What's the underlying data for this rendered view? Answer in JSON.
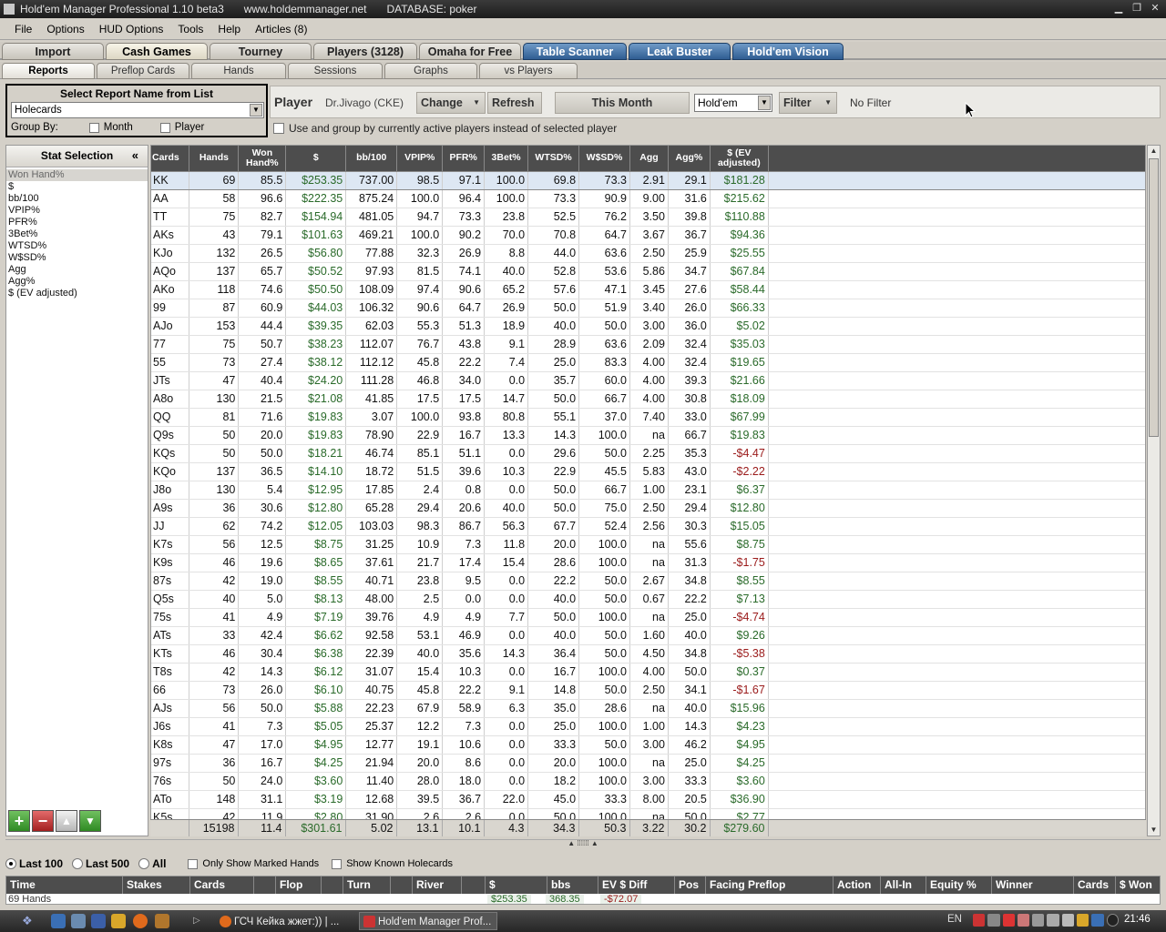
{
  "titlebar": {
    "app": "Hold'em Manager Professional 1.10 beta3",
    "site": "www.holdemmanager.net",
    "database": "DATABASE: poker"
  },
  "menu": [
    "File",
    "Options",
    "HUD Options",
    "Tools",
    "Help",
    "Articles (8)"
  ],
  "main_tabs": [
    "Import",
    "Cash Games",
    "Tourney",
    "Players (3128)",
    "Omaha for Free",
    "Table Scanner",
    "Leak Buster",
    "Hold'em Vision"
  ],
  "sub_tabs": [
    "Reports",
    "Preflop Cards",
    "Hands",
    "Sessions",
    "Graphs",
    "vs Players"
  ],
  "report_select": {
    "title": "Select Report Name from List",
    "value": "Holecards",
    "group_by": "Group By:",
    "month": "Month",
    "player": "Player"
  },
  "player_bar": {
    "label": "Player",
    "name": "Dr.Jivago (CKE)",
    "change": "Change",
    "refresh": "Refresh",
    "period": "This Month",
    "game": "Hold'em",
    "filter": "Filter",
    "filter_value": "No Filter"
  },
  "active_players_label": "Use and group by currently active players instead of selected player",
  "stat_selection": {
    "title": "Stat Selection",
    "collapse": "«",
    "items": [
      "Won Hand%",
      "$",
      "bb/100",
      "VPIP%",
      "PFR%",
      "3Bet%",
      "WTSD%",
      "W$SD%",
      "Agg",
      "Agg%",
      "$ (EV adjusted)"
    ],
    "buttons": [
      "+",
      "−",
      "▲",
      "▼"
    ]
  },
  "grid": {
    "columns": [
      "Cards",
      "Hands",
      "Won Hand%",
      "$",
      "bb/100",
      "VPIP%",
      "PFR%",
      "3Bet%",
      "WTSD%",
      "W$SD%",
      "Agg",
      "Agg%",
      "$ (EV adjusted)"
    ],
    "rows": [
      [
        "KK",
        "69",
        "85.5",
        "$253.35",
        "737.00",
        "98.5",
        "97.1",
        "100.0",
        "69.8",
        "73.3",
        "2.91",
        "29.1",
        "$181.28"
      ],
      [
        "AA",
        "58",
        "96.6",
        "$222.35",
        "875.24",
        "100.0",
        "96.4",
        "100.0",
        "73.3",
        "90.9",
        "9.00",
        "31.6",
        "$215.62"
      ],
      [
        "TT",
        "75",
        "82.7",
        "$154.94",
        "481.05",
        "94.7",
        "73.3",
        "23.8",
        "52.5",
        "76.2",
        "3.50",
        "39.8",
        "$110.88"
      ],
      [
        "AKs",
        "43",
        "79.1",
        "$101.63",
        "469.21",
        "100.0",
        "90.2",
        "70.0",
        "70.8",
        "64.7",
        "3.67",
        "36.7",
        "$94.36"
      ],
      [
        "KJo",
        "132",
        "26.5",
        "$56.80",
        "77.88",
        "32.3",
        "26.9",
        "8.8",
        "44.0",
        "63.6",
        "2.50",
        "25.9",
        "$25.55"
      ],
      [
        "AQo",
        "137",
        "65.7",
        "$50.52",
        "97.93",
        "81.5",
        "74.1",
        "40.0",
        "52.8",
        "53.6",
        "5.86",
        "34.7",
        "$67.84"
      ],
      [
        "AKo",
        "118",
        "74.6",
        "$50.50",
        "108.09",
        "97.4",
        "90.6",
        "65.2",
        "57.6",
        "47.1",
        "3.45",
        "27.6",
        "$58.44"
      ],
      [
        "99",
        "87",
        "60.9",
        "$44.03",
        "106.32",
        "90.6",
        "64.7",
        "26.9",
        "50.0",
        "51.9",
        "3.40",
        "26.0",
        "$66.33"
      ],
      [
        "AJo",
        "153",
        "44.4",
        "$39.35",
        "62.03",
        "55.3",
        "51.3",
        "18.9",
        "40.0",
        "50.0",
        "3.00",
        "36.0",
        "$5.02"
      ],
      [
        "77",
        "75",
        "50.7",
        "$38.23",
        "112.07",
        "76.7",
        "43.8",
        "9.1",
        "28.9",
        "63.6",
        "2.09",
        "32.4",
        "$35.03"
      ],
      [
        "55",
        "73",
        "27.4",
        "$38.12",
        "112.12",
        "45.8",
        "22.2",
        "7.4",
        "25.0",
        "83.3",
        "4.00",
        "32.4",
        "$19.65"
      ],
      [
        "JTs",
        "47",
        "40.4",
        "$24.20",
        "111.28",
        "46.8",
        "34.0",
        "0.0",
        "35.7",
        "60.0",
        "4.00",
        "39.3",
        "$21.66"
      ],
      [
        "A8o",
        "130",
        "21.5",
        "$21.08",
        "41.85",
        "17.5",
        "17.5",
        "14.7",
        "50.0",
        "66.7",
        "4.00",
        "30.8",
        "$18.09"
      ],
      [
        "QQ",
        "81",
        "71.6",
        "$19.83",
        "3.07",
        "100.0",
        "93.8",
        "80.8",
        "55.1",
        "37.0",
        "7.40",
        "33.0",
        "$67.99"
      ],
      [
        "Q9s",
        "50",
        "20.0",
        "$19.83",
        "78.90",
        "22.9",
        "16.7",
        "13.3",
        "14.3",
        "100.0",
        "na",
        "66.7",
        "$19.83"
      ],
      [
        "KQs",
        "50",
        "50.0",
        "$18.21",
        "46.74",
        "85.1",
        "51.1",
        "0.0",
        "29.6",
        "50.0",
        "2.25",
        "35.3",
        "-$4.47"
      ],
      [
        "KQo",
        "137",
        "36.5",
        "$14.10",
        "18.72",
        "51.5",
        "39.6",
        "10.3",
        "22.9",
        "45.5",
        "5.83",
        "43.0",
        "-$2.22"
      ],
      [
        "J8o",
        "130",
        "5.4",
        "$12.95",
        "17.85",
        "2.4",
        "0.8",
        "0.0",
        "50.0",
        "66.7",
        "1.00",
        "23.1",
        "$6.37"
      ],
      [
        "A9s",
        "36",
        "30.6",
        "$12.80",
        "65.28",
        "29.4",
        "20.6",
        "40.0",
        "50.0",
        "75.0",
        "2.50",
        "29.4",
        "$12.80"
      ],
      [
        "JJ",
        "62",
        "74.2",
        "$12.05",
        "103.03",
        "98.3",
        "86.7",
        "56.3",
        "67.7",
        "52.4",
        "2.56",
        "30.3",
        "$15.05"
      ],
      [
        "K7s",
        "56",
        "12.5",
        "$8.75",
        "31.25",
        "10.9",
        "7.3",
        "11.8",
        "20.0",
        "100.0",
        "na",
        "55.6",
        "$8.75"
      ],
      [
        "K9s",
        "46",
        "19.6",
        "$8.65",
        "37.61",
        "21.7",
        "17.4",
        "15.4",
        "28.6",
        "100.0",
        "na",
        "31.3",
        "-$1.75"
      ],
      [
        "87s",
        "42",
        "19.0",
        "$8.55",
        "40.71",
        "23.8",
        "9.5",
        "0.0",
        "22.2",
        "50.0",
        "2.67",
        "34.8",
        "$8.55"
      ],
      [
        "Q5s",
        "40",
        "5.0",
        "$8.13",
        "48.00",
        "2.5",
        "0.0",
        "0.0",
        "40.0",
        "50.0",
        "0.67",
        "22.2",
        "$7.13"
      ],
      [
        "75s",
        "41",
        "4.9",
        "$7.19",
        "39.76",
        "4.9",
        "4.9",
        "7.7",
        "50.0",
        "100.0",
        "na",
        "25.0",
        "-$4.74"
      ],
      [
        "ATs",
        "33",
        "42.4",
        "$6.62",
        "92.58",
        "53.1",
        "46.9",
        "0.0",
        "40.0",
        "50.0",
        "1.60",
        "40.0",
        "$9.26"
      ],
      [
        "KTs",
        "46",
        "30.4",
        "$6.38",
        "22.39",
        "40.0",
        "35.6",
        "14.3",
        "36.4",
        "50.0",
        "4.50",
        "34.8",
        "-$5.38"
      ],
      [
        "T8s",
        "42",
        "14.3",
        "$6.12",
        "31.07",
        "15.4",
        "10.3",
        "0.0",
        "16.7",
        "100.0",
        "4.00",
        "50.0",
        "$0.37"
      ],
      [
        "66",
        "73",
        "26.0",
        "$6.10",
        "40.75",
        "45.8",
        "22.2",
        "9.1",
        "14.8",
        "50.0",
        "2.50",
        "34.1",
        "-$1.67"
      ],
      [
        "AJs",
        "56",
        "50.0",
        "$5.88",
        "22.23",
        "67.9",
        "58.9",
        "6.3",
        "35.0",
        "28.6",
        "na",
        "40.0",
        "$15.96"
      ],
      [
        "J6s",
        "41",
        "7.3",
        "$5.05",
        "25.37",
        "12.2",
        "7.3",
        "0.0",
        "25.0",
        "100.0",
        "1.00",
        "14.3",
        "$4.23"
      ],
      [
        "K8s",
        "47",
        "17.0",
        "$4.95",
        "12.77",
        "19.1",
        "10.6",
        "0.0",
        "33.3",
        "50.0",
        "3.00",
        "46.2",
        "$4.95"
      ],
      [
        "97s",
        "36",
        "16.7",
        "$4.25",
        "21.94",
        "20.0",
        "8.6",
        "0.0",
        "20.0",
        "100.0",
        "na",
        "25.0",
        "$4.25"
      ],
      [
        "76s",
        "50",
        "24.0",
        "$3.60",
        "11.40",
        "28.0",
        "18.0",
        "0.0",
        "18.2",
        "100.0",
        "3.00",
        "33.3",
        "$3.60"
      ],
      [
        "ATo",
        "148",
        "31.1",
        "$3.19",
        "12.68",
        "39.5",
        "36.7",
        "22.0",
        "45.0",
        "33.3",
        "8.00",
        "20.5",
        "$36.90"
      ],
      [
        "K5s",
        "42",
        "11.9",
        "$2.80",
        "31.90",
        "2.6",
        "2.6",
        "0.0",
        "50.0",
        "100.0",
        "na",
        "50.0",
        "$2.77"
      ]
    ],
    "totals": [
      "",
      "15198",
      "11.4",
      "$301.61",
      "5.02",
      "13.1",
      "10.1",
      "4.3",
      "34.3",
      "50.3",
      "3.22",
      "30.2",
      "$279.60"
    ]
  },
  "bottom_controls": {
    "last100": "Last 100",
    "last500": "Last 500",
    "all": "All",
    "marked": "Only Show Marked Hands",
    "known": "Show Known Holecards"
  },
  "hands_grid": {
    "columns": [
      "Time",
      "Stakes",
      "Cards",
      "Flop",
      "Turn",
      "River",
      "$",
      "bbs",
      "EV $ Diff",
      "Pos",
      "Facing Preflop",
      "Action",
      "All-In",
      "Equity %",
      "Winner",
      "Cards",
      "$ Won"
    ],
    "partial_row": {
      "label": "69 Hands",
      "dollars": "$253.35",
      "bbs": "368.35",
      "ev_diff": "-$72.07"
    }
  },
  "taskbar": {
    "item1": "ГСЧ Кейка жжет:)) | ...",
    "item2": "Hold'em Manager Prof...",
    "lang": "EN",
    "clock": "21:46"
  },
  "colors": {
    "positive": "#2a6a2a",
    "negative": "#9a1a1a",
    "tab_blue": "#2f5d92",
    "header_dark": "#4d4d4d"
  }
}
